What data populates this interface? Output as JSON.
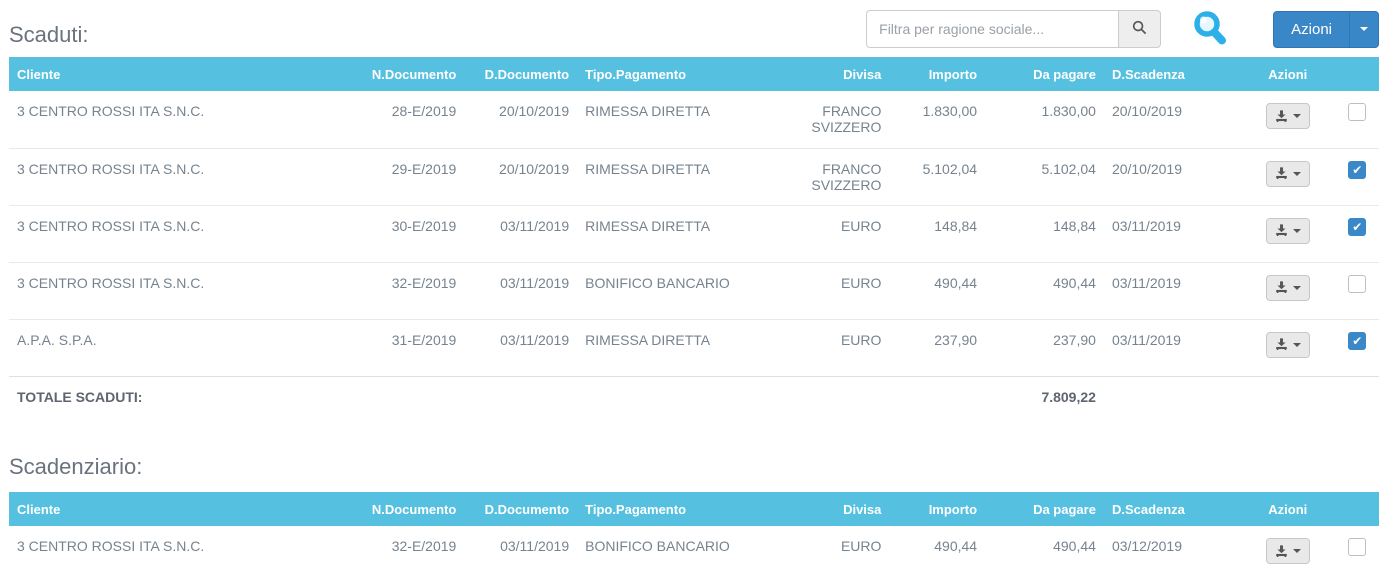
{
  "colors": {
    "table_header_bg": "#56c0e0",
    "primary_button": "#3a87c8",
    "checkbox_checked": "#3b88c8",
    "cell_text": "#76838f"
  },
  "icons": {
    "filter_search": "magnifier-icon",
    "big_search": "blue-magnifier-icon",
    "row_action": "download-icon",
    "dropdown": "caret-down-icon"
  },
  "filter": {
    "placeholder": "Filtra per ragione sociale..."
  },
  "actions": {
    "label": "Azioni"
  },
  "sections": [
    {
      "title": "Scaduti:",
      "columns": [
        "Cliente",
        "N.Documento",
        "D.Documento",
        "Tipo.Pagamento",
        "Divisa",
        "Importo",
        "Da pagare",
        "D.Scadenza",
        "Azioni"
      ],
      "rows": [
        {
          "cliente": "3 CENTRO ROSSI ITA S.N.C.",
          "n_documento": "28-E/2019",
          "d_documento": "20/10/2019",
          "tipo_pagamento": "RIMESSA DIRETTA",
          "divisa": "FRANCO SVIZZERO",
          "importo": "1.830,00",
          "da_pagare": "1.830,00",
          "d_scadenza": "20/10/2019",
          "checked": false
        },
        {
          "cliente": "3 CENTRO ROSSI ITA S.N.C.",
          "n_documento": "29-E/2019",
          "d_documento": "20/10/2019",
          "tipo_pagamento": "RIMESSA DIRETTA",
          "divisa": "FRANCO SVIZZERO",
          "importo": "5.102,04",
          "da_pagare": "5.102,04",
          "d_scadenza": "20/10/2019",
          "checked": true
        },
        {
          "cliente": "3 CENTRO ROSSI ITA S.N.C.",
          "n_documento": "30-E/2019",
          "d_documento": "03/11/2019",
          "tipo_pagamento": "RIMESSA DIRETTA",
          "divisa": "EURO",
          "importo": "148,84",
          "da_pagare": "148,84",
          "d_scadenza": "03/11/2019",
          "checked": true
        },
        {
          "cliente": "3 CENTRO ROSSI ITA S.N.C.",
          "n_documento": "32-E/2019",
          "d_documento": "03/11/2019",
          "tipo_pagamento": "BONIFICO BANCARIO",
          "divisa": "EURO",
          "importo": "490,44",
          "da_pagare": "490,44",
          "d_scadenza": "03/11/2019",
          "checked": false
        },
        {
          "cliente": "A.P.A. S.P.A.",
          "n_documento": "31-E/2019",
          "d_documento": "03/11/2019",
          "tipo_pagamento": "RIMESSA DIRETTA",
          "divisa": "EURO",
          "importo": "237,90",
          "da_pagare": "237,90",
          "d_scadenza": "03/11/2019",
          "checked": true
        }
      ],
      "total_label": "TOTALE SCADUTI:",
      "total_value": "7.809,22"
    },
    {
      "title": "Scadenziario:",
      "columns": [
        "Cliente",
        "N.Documento",
        "D.Documento",
        "Tipo.Pagamento",
        "Divisa",
        "Importo",
        "Da pagare",
        "D.Scadenza",
        "Azioni"
      ],
      "rows": [
        {
          "cliente": "3 CENTRO ROSSI ITA S.N.C.",
          "n_documento": "32-E/2019",
          "d_documento": "03/11/2019",
          "tipo_pagamento": "BONIFICO BANCARIO",
          "divisa": "EURO",
          "importo": "490,44",
          "da_pagare": "490,44",
          "d_scadenza": "03/12/2019",
          "checked": false
        }
      ]
    }
  ]
}
